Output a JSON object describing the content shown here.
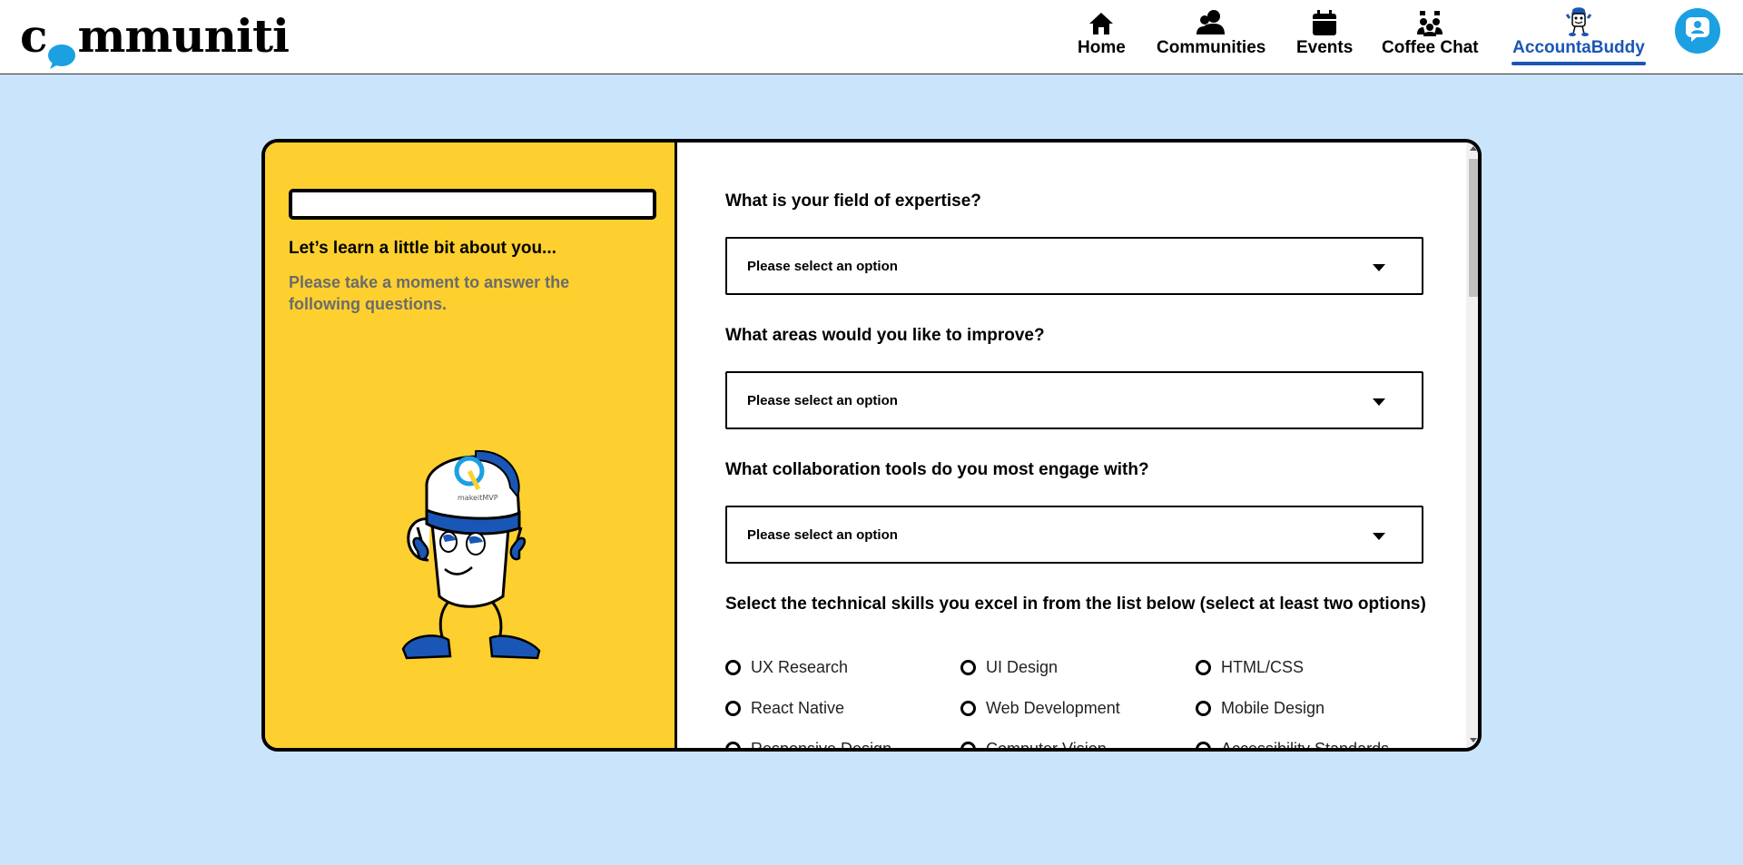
{
  "header": {
    "logo_text_before": "c",
    "logo_text_after": "mmuniti",
    "nav": [
      {
        "label": "Home",
        "icon": "home-icon"
      },
      {
        "label": "Communities",
        "icon": "communities-icon"
      },
      {
        "label": "Events",
        "icon": "calendar-icon"
      },
      {
        "label": "Coffee Chat",
        "icon": "coffee-chat-icon"
      },
      {
        "label": "AccountaBuddy",
        "icon": "accountabuddy-mascot-icon",
        "active": true
      }
    ],
    "profile_icon": "user-profile-icon"
  },
  "left_panel": {
    "progress": 0,
    "title": "Let’s learn a little bit about you...",
    "subtitle": "Please take a moment to answer the following questions.",
    "mascot_cap_text": "makeitMVP"
  },
  "form": {
    "questions": [
      {
        "label": "What is your field of expertise?",
        "placeholder": "Please select an option"
      },
      {
        "label": "What areas would you like to improve?",
        "placeholder": "Please select an option"
      },
      {
        "label": "What collaboration tools do you most engage with?",
        "placeholder": "Please select an option"
      }
    ],
    "skills_label": "Select the technical skills you excel in from the list below (select at least two options)",
    "skills": [
      "UX Research",
      "UI Design",
      "HTML/CSS",
      "React Native",
      "Web Development",
      "Mobile Design",
      "Responsive Design",
      "Computer Vision",
      "Accessibility Standards"
    ]
  },
  "colors": {
    "page_bg": "#cae4fb",
    "panel_yellow": "#fdd02f",
    "accent_blue": "#1a56b5",
    "avatar_blue": "#1ba0e2"
  }
}
